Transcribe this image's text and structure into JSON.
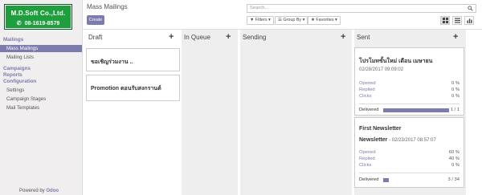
{
  "colors": {
    "accent": "#7c7bad",
    "logo_bg": "#1e9e3c"
  },
  "logo": {
    "line1": "M.D.Soft Co.,Ltd.",
    "line2": "08-1619-8579"
  },
  "sidebar": {
    "sections": [
      {
        "label": "Mailings",
        "items": [
          "Mass Mailings",
          "Mailing Lists"
        ]
      },
      {
        "label": "Campaigns",
        "items": []
      },
      {
        "label": "Reports",
        "items": []
      },
      {
        "label": "Configuration",
        "items": [
          "Settings",
          "Campaign Stages",
          "Mail Templates"
        ]
      }
    ],
    "active_item": "Mass Mailings"
  },
  "powered": {
    "prefix": "Powered by ",
    "brand": "Odoo"
  },
  "header": {
    "title": "Mass Mailings",
    "create_label": "Create",
    "search_placeholder": "Search...",
    "filters_label": "Filters",
    "group_by_label": "Group By",
    "favorites_label": "Favorites",
    "views": [
      "kanban-view-icon",
      "list-view-icon",
      "graph-view-icon"
    ],
    "active_view": "kanban-view-icon"
  },
  "columns": [
    {
      "title": "Draft",
      "cards": [
        {
          "title": "ขอเชิญร่วมงาน .."
        },
        {
          "title": "Promotion ตอนรับสงกรานต์"
        }
      ]
    },
    {
      "title": "In Queue",
      "cards": []
    },
    {
      "title": "Sending",
      "cards": []
    },
    {
      "title": "Sent",
      "cards": [
        {
          "title": "โปรโมทขั้นใหม่ เดือน เมษายน",
          "subtitle": "",
          "date": "02/28/2017 09:09:02",
          "stats": [
            {
              "label": "Opened",
              "value": "0 %"
            },
            {
              "label": "Replied",
              "value": "0 %"
            },
            {
              "label": "Clicks",
              "value": "0 %"
            }
          ],
          "delivered_label": "Delivered",
          "delivered_value": "1 / 1",
          "delivered_ratio": 1.0
        },
        {
          "title": "First Newsletter",
          "subtitle": "Newsletter",
          "date": " - 02/23/2017 08:57:07",
          "stats": [
            {
              "label": "Opened",
              "value": "60 %"
            },
            {
              "label": "Replied",
              "value": "40 %"
            },
            {
              "label": "Clicks",
              "value": "0 %"
            }
          ],
          "delivered_label": "Delivered",
          "delivered_value": "3 / 34",
          "delivered_ratio": 0.088
        }
      ]
    }
  ]
}
